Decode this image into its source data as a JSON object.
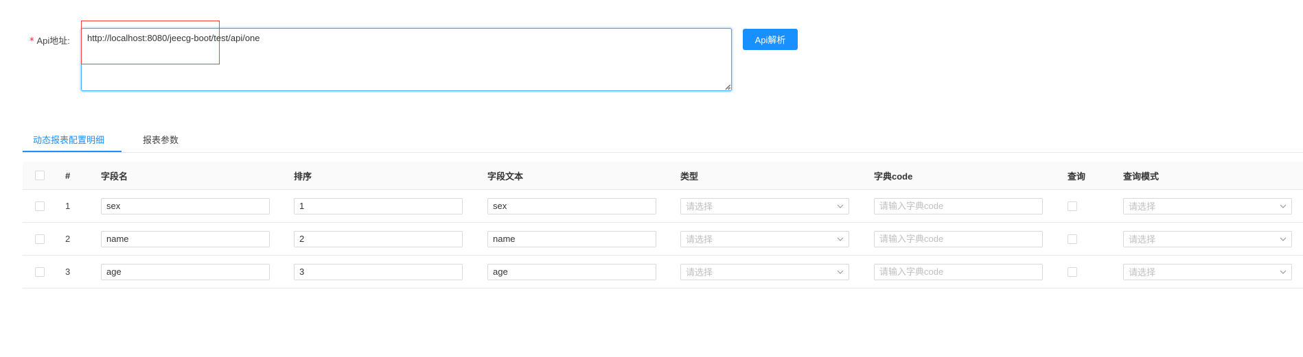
{
  "form": {
    "required_mark": "*",
    "api_label": "Api地址:",
    "api_value": "http://localhost:8080/jeecg-boot/test/api/one",
    "parse_button": "Api解析"
  },
  "tabs": [
    {
      "label": "动态报表配置明细",
      "active": true
    },
    {
      "label": "报表参数",
      "active": false
    }
  ],
  "table": {
    "headers": {
      "index": "#",
      "field_name": "字段名",
      "order": "排序",
      "field_text": "字段文本",
      "type": "类型",
      "dict_code": "字典code",
      "query": "查询",
      "query_mode": "查询模式"
    },
    "rows": [
      {
        "index": "1",
        "field_name": "sex",
        "order": "1",
        "field_text": "sex"
      },
      {
        "index": "2",
        "field_name": "name",
        "order": "2",
        "field_text": "name"
      },
      {
        "index": "3",
        "field_name": "age",
        "order": "3",
        "field_text": "age"
      }
    ],
    "select_placeholder": "请选择",
    "dict_placeholder": "请输入字典code"
  },
  "icons": {
    "select_arrow": "chevron-down-icon",
    "resize": "resize-grip-icon"
  },
  "colors": {
    "primary": "#1890ff",
    "required": "#f5222d",
    "highlight": "#ff3b3b"
  }
}
